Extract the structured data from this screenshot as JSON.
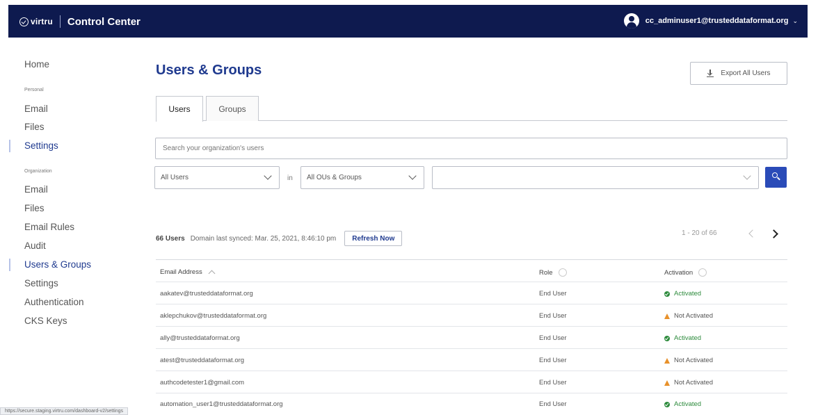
{
  "topbar": {
    "logo_text": "virtru",
    "app_title": "Control Center",
    "account_email": "cc_adminuser1@trusteddataformat.org",
    "account_chevron": "⌄"
  },
  "sidebar": {
    "home": "Home",
    "personal_label": "Personal",
    "personal_items": [
      "Email",
      "Files",
      "Settings"
    ],
    "organization_label": "Organization",
    "organization_items": [
      "Email",
      "Files",
      "Email Rules",
      "Audit",
      "Users & Groups",
      "Settings",
      "Authentication",
      "CKS Keys"
    ]
  },
  "main": {
    "title": "Users & Groups",
    "export_label": "Export All Users",
    "tabs": [
      {
        "label": "Users",
        "selected": true
      },
      {
        "label": "Groups",
        "selected": false
      }
    ],
    "search_placeholder": "Search your organization's users",
    "filter_users": "All Users",
    "in_label": "in",
    "filter_ous": "All OUs & Groups",
    "filter_value": ""
  },
  "summary": {
    "count": "66 Users",
    "sync_text": "Domain last synced: Mar. 25, 2021, 8:46:10 pm",
    "refresh_label": "Refresh Now",
    "paging": "1 - 20 of 66"
  },
  "table": {
    "headers": {
      "email": "Email Address",
      "role": "Role",
      "activation": "Activation"
    },
    "rows": [
      {
        "email": "aakatev@trusteddataformat.org",
        "role": "End User",
        "status": "Activated",
        "ok": true
      },
      {
        "email": "aklepchukov@trusteddataformat.org",
        "role": "End User",
        "status": "Not Activated",
        "ok": false
      },
      {
        "email": "ally@trusteddataformat.org",
        "role": "End User",
        "status": "Activated",
        "ok": true
      },
      {
        "email": "atest@trusteddataformat.org",
        "role": "End User",
        "status": "Not Activated",
        "ok": false
      },
      {
        "email": "authcodetester1@gmail.com",
        "role": "End User",
        "status": "Not Activated",
        "ok": false
      },
      {
        "email": "automation_user1@trusteddataformat.org",
        "role": "End User",
        "status": "Activated",
        "ok": true
      }
    ]
  },
  "colors": {
    "navy": "#0e1a4f",
    "accent": "#1f3a8f",
    "button": "#2a4bb8",
    "success": "#2e8b3d",
    "warning": "#e8912a"
  },
  "status_bar_url": "https://secure.staging.virtru.com/dashboard-v2/settings"
}
